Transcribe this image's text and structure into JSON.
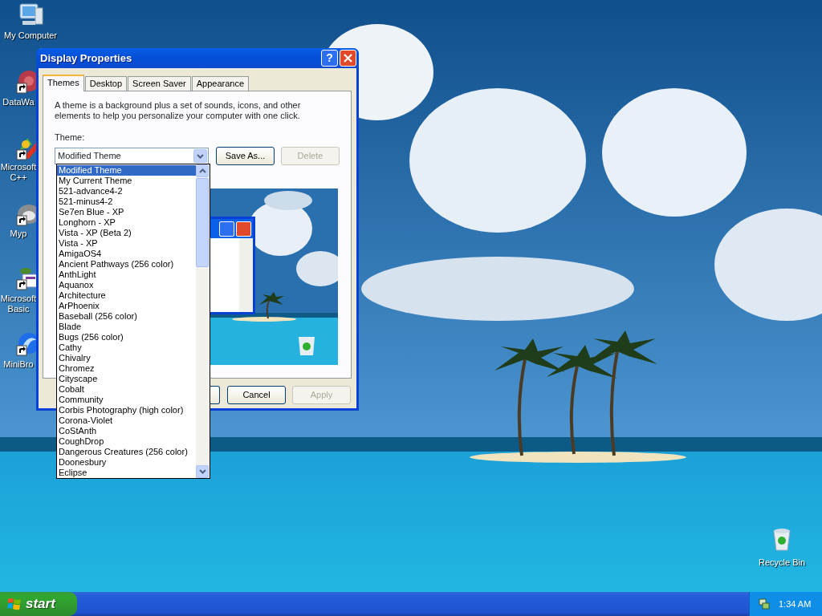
{
  "desktop_icons": [
    {
      "label": "My Computer",
      "shortcut": false
    },
    {
      "label": "DataWa",
      "shortcut": true
    },
    {
      "label": "Microsoft C++",
      "shortcut": true
    },
    {
      "label": "Myp",
      "shortcut": true
    },
    {
      "label": "Microsoft Basic",
      "shortcut": true
    },
    {
      "label": "MiniBro",
      "shortcut": true
    },
    {
      "label": "Recycle Bin",
      "shortcut": false
    }
  ],
  "dialog": {
    "title": "Display Properties",
    "help_button": "?",
    "tabs": [
      {
        "label": "Themes",
        "selected": true
      },
      {
        "label": "Desktop",
        "selected": false
      },
      {
        "label": "Screen Saver",
        "selected": false
      },
      {
        "label": "Appearance",
        "selected": false
      }
    ],
    "description": "A theme is a background plus a set of sounds, icons, and other elements to help you personalize your computer with one click.",
    "theme_label": "Theme:",
    "theme_select": {
      "value": "Modified Theme",
      "expanded": true
    },
    "theme_buttons": [
      {
        "label": "Save As...",
        "disabled": false
      },
      {
        "label": "Delete",
        "disabled": true
      }
    ],
    "theme_list": [
      {
        "label": "Modified Theme",
        "selected": true
      },
      {
        "label": "My Current Theme",
        "selected": false
      },
      {
        "label": "521-advance4-2",
        "selected": false
      },
      {
        "label": "521-minus4-2",
        "selected": false
      },
      {
        "label": "Se7en Blue - XP",
        "selected": false
      },
      {
        "label": "Longhorn - XP",
        "selected": false
      },
      {
        "label": "Vista - XP (Beta 2)",
        "selected": false
      },
      {
        "label": "Vista - XP",
        "selected": false
      },
      {
        "label": "AmigaOS4",
        "selected": false
      },
      {
        "label": "Ancient Pathways (256 color)",
        "selected": false
      },
      {
        "label": "AnthLight",
        "selected": false
      },
      {
        "label": "Aquanox",
        "selected": false
      },
      {
        "label": "Architecture",
        "selected": false
      },
      {
        "label": "ArPhoenix",
        "selected": false
      },
      {
        "label": "Baseball (256 color)",
        "selected": false
      },
      {
        "label": "Blade",
        "selected": false
      },
      {
        "label": "Bugs (256 color)",
        "selected": false
      },
      {
        "label": "Cathy",
        "selected": false
      },
      {
        "label": "Chivalry",
        "selected": false
      },
      {
        "label": "Chromez",
        "selected": false
      },
      {
        "label": "Cityscape",
        "selected": false
      },
      {
        "label": "Cobalt",
        "selected": false
      },
      {
        "label": "Community",
        "selected": false
      },
      {
        "label": "Corbis Photography (high color)",
        "selected": false
      },
      {
        "label": "Corona-Violet",
        "selected": false
      },
      {
        "label": "CoStAnth",
        "selected": false
      },
      {
        "label": "CoughDrop",
        "selected": false
      },
      {
        "label": "Dangerous Creatures (256 color)",
        "selected": false
      },
      {
        "label": "Doonesbury",
        "selected": false
      },
      {
        "label": "Eclipse",
        "selected": false
      }
    ],
    "footer_buttons": [
      {
        "label": "Cancel",
        "disabled": false
      },
      {
        "label": "Apply",
        "disabled": true
      }
    ]
  },
  "taskbar": {
    "start": "start",
    "clock": "1:34 AM"
  }
}
